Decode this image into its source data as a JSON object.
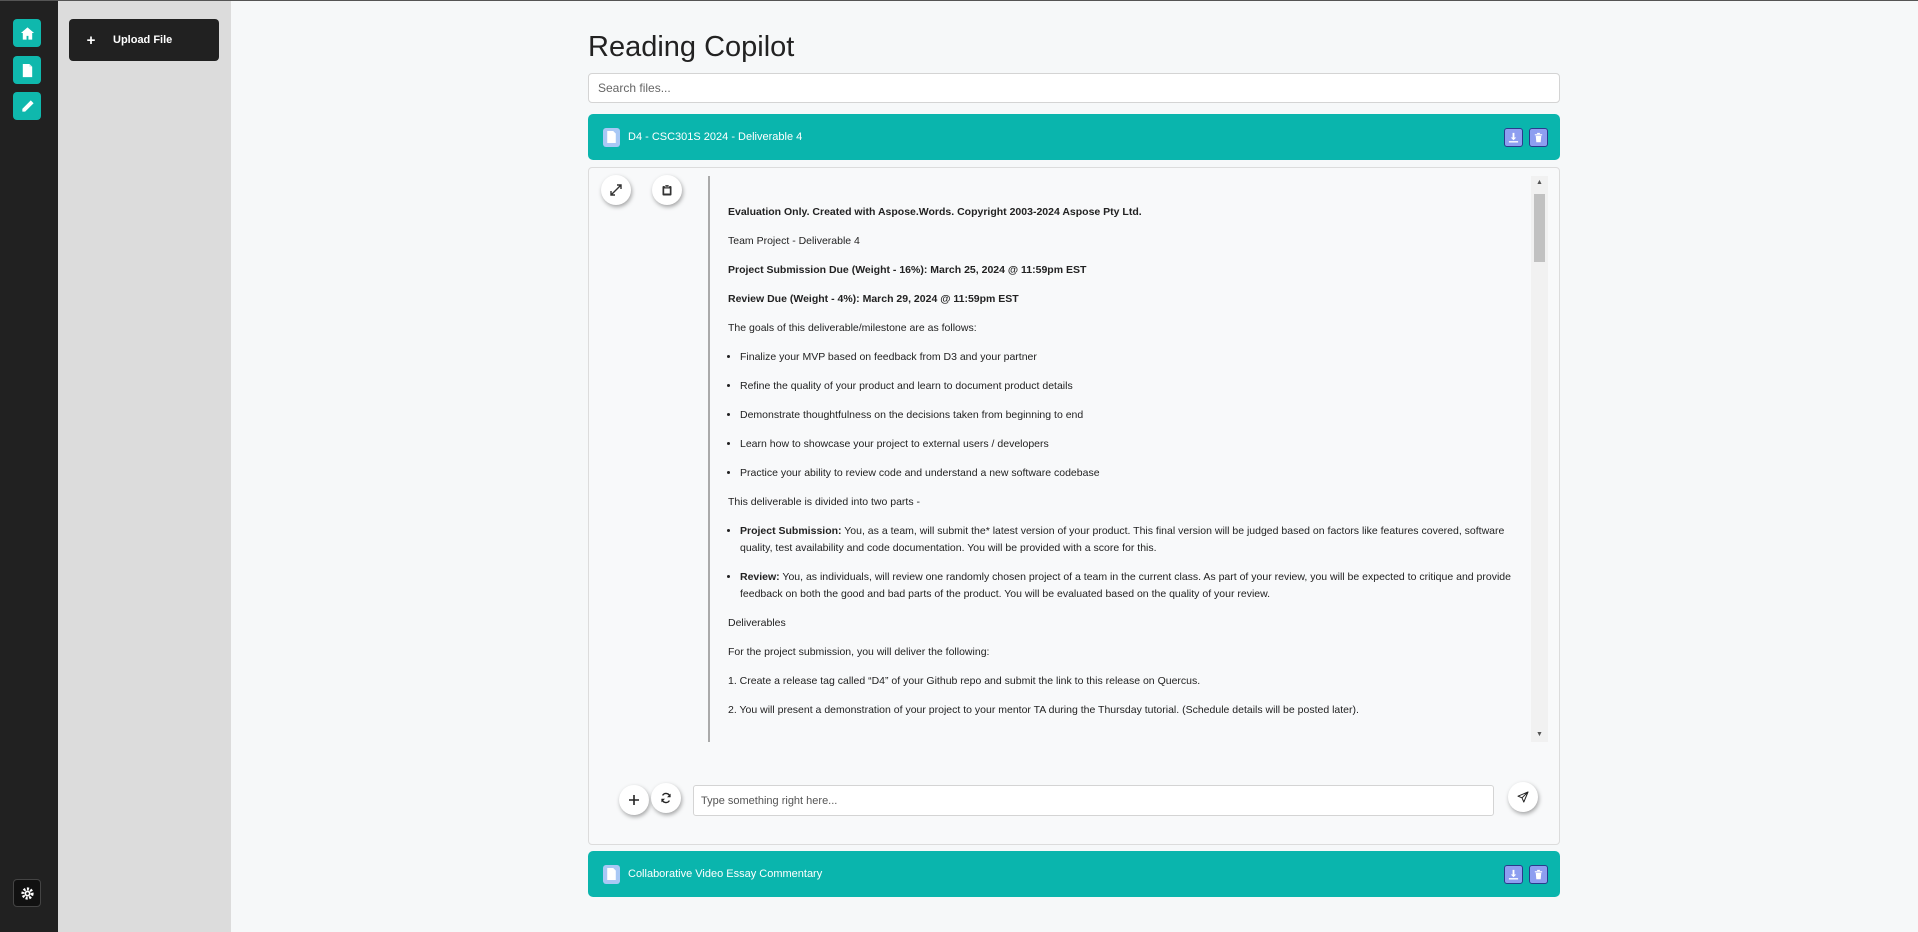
{
  "app": {
    "title": "Reading Copilot"
  },
  "rail": {
    "home": "home-icon",
    "documents": "document-icon",
    "edit": "pencil-icon",
    "settings": "gear-icon"
  },
  "sidebar": {
    "upload_label": "Upload File",
    "upload_icon": "+"
  },
  "search": {
    "placeholder": "Search files..."
  },
  "files": [
    {
      "name": "D4 - CSC301S 2024 - Deliverable 4"
    },
    {
      "name": "Collaborative Video Essay Commentary"
    }
  ],
  "document": {
    "watermark": "Evaluation Only. Created with Aspose.Words. Copyright 2003-2024 Aspose Pty Ltd.",
    "subtitle": "Team Project - Deliverable 4",
    "due_project": "Project Submission Due (Weight - 16%): March 25, 2024 @ 11:59pm EST",
    "due_review": "Review Due (Weight - 4%): March 29, 2024 @ 11:59pm EST",
    "goals_intro": "The goals of this deliverable/milestone are as follows:",
    "goals": [
      "Finalize your MVP based on feedback from D3 and your partner",
      "Refine the quality of your product and learn to document product details",
      "Demonstrate thoughtfulness on the decisions taken from beginning to end",
      "Learn how to showcase your project to external users / developers",
      "Practice your ability to review code and understand a new software codebase"
    ],
    "parts_intro": "This deliverable is divided into two parts -",
    "parts": [
      {
        "label": "Project Submission:",
        "text": " You, as a team, will submit the* latest version of your product. This final version will be judged based on factors like features covered, software quality, test availability and code documentation. You will be provided with a score for this."
      },
      {
        "label": "Review:",
        "text": " You, as individuals, will review one randomly chosen project of a team in the current class. As part of your review, you will be expected to critique and provide feedback on both the good and bad parts of the product. You will be evaluated based on the quality of your review."
      }
    ],
    "deliverables_heading": "Deliverables",
    "deliverables_intro": "For the project submission, you will deliver the following:",
    "steps": [
      "1. Create a release tag called “D4” of your Github repo and submit the link to this release on Quercus.",
      "2. You will present a demonstration of your project to your mentor TA during the Thursday tutorial. (Schedule details will be posted later)."
    ]
  },
  "viewer_controls": {
    "expand": "expand-icon",
    "clipboard": "clipboard-icon"
  },
  "chat": {
    "placeholder": "Type something right here...",
    "add": "plus-icon",
    "refresh": "refresh-icon",
    "send": "send-icon"
  },
  "colors": {
    "accent": "#0ab5ad",
    "rail": "#212121",
    "panel": "#dcdcdc",
    "action": "#8d9ef0"
  }
}
